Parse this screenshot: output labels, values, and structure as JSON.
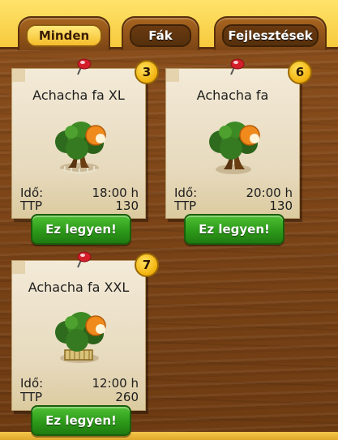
{
  "tabs": [
    {
      "label": "Minden",
      "active": true
    },
    {
      "label": "Fák",
      "active": false
    },
    {
      "label": "Fejlesztések",
      "active": false
    }
  ],
  "cards": [
    {
      "title": "Achacha fa XL",
      "count": "3",
      "time_label": "Idő:",
      "time_value": "18:00 h",
      "ttp_label": "TTP",
      "ttp_value": "130",
      "button": "Ez legyen!"
    },
    {
      "title": "Achacha fa",
      "count": "6",
      "time_label": "Idő:",
      "time_value": "20:00 h",
      "ttp_label": "TTP",
      "ttp_value": "130",
      "button": "Ez legyen!"
    },
    {
      "title": "Achacha fa XXL",
      "count": "7",
      "time_label": "Idő:",
      "time_value": "12:00 h",
      "ttp_label": "TTP",
      "ttp_value": "260",
      "button": "Ez legyen!"
    }
  ],
  "colors": {
    "wood": "#7a4517",
    "accent_yellow": "#f6c83a",
    "button_green": "#2d9a1a"
  },
  "icons": {
    "pin": "pin-icon",
    "tree": "tree-with-fruit-icon"
  }
}
